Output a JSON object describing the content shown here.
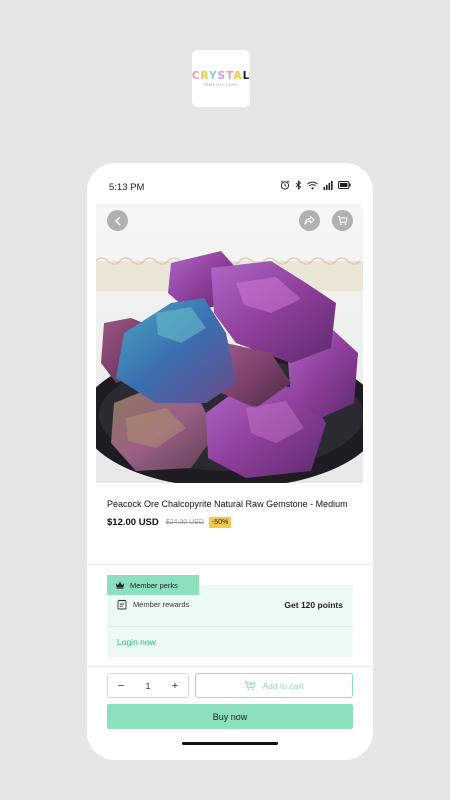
{
  "app_logo": {
    "brand": [
      "C",
      "R",
      "Y",
      "S",
      "T",
      "A",
      "L"
    ],
    "tagline": "JEWELRY CORP"
  },
  "status_bar": {
    "time": "5:13 PM"
  },
  "hero": {
    "icons": [
      "back-icon",
      "share-icon",
      "cart-icon"
    ]
  },
  "product": {
    "title": "Peacock Ore Chalcopyrite Natural Raw Gemstone - Medium",
    "price": "$12.00 USD",
    "old_price": "$24.00 USD",
    "discount": "-50%"
  },
  "perks": {
    "tab_label": "Member perks",
    "rewards_label": "Member rewards",
    "rewards_value": "Get 120 points",
    "login_label": "Login now"
  },
  "purchase": {
    "quantity": "1",
    "minus": "−",
    "plus": "+",
    "add_to_cart_label": "Add to cart",
    "buy_now_label": "Buy now"
  },
  "colors": {
    "accent": "#8de0bd",
    "link": "#2fb47d",
    "discount_badge": "#f2c94c"
  }
}
